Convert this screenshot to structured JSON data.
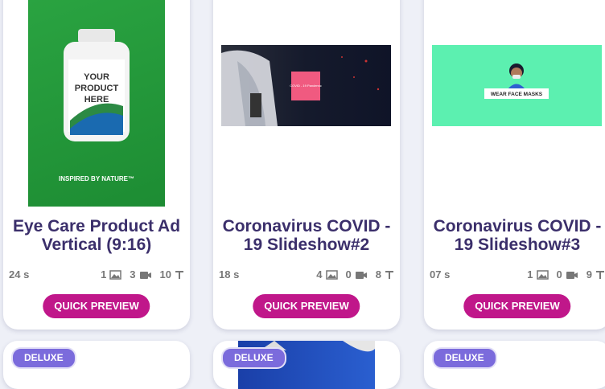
{
  "cards": [
    {
      "title": "Eye Care Product Ad Vertical (9:16)",
      "duration": "24 s",
      "images": "1",
      "videos": "3",
      "texts": "10",
      "preview_label": "QUICK PREVIEW",
      "thumb_text": {
        "line1": "YOUR",
        "line2": "PRODUCT",
        "line3": "HERE",
        "tagline": "INSPIRED BY NATURE™"
      }
    },
    {
      "title": "Coronavirus COVID - 19 Slideshow#2",
      "duration": "18 s",
      "images": "4",
      "videos": "0",
      "texts": "8",
      "preview_label": "QUICK PREVIEW",
      "thumb_text": {
        "box": "COVID - 19 Pandemic"
      }
    },
    {
      "title": "Coronavirus COVID - 19 Slideshow#3",
      "duration": "07 s",
      "images": "1",
      "videos": "0",
      "texts": "9",
      "preview_label": "QUICK PREVIEW",
      "thumb_text": {
        "banner": "WEAR FACE MASKS"
      }
    }
  ],
  "bottom_cards": [
    {
      "badge": "DELUXE"
    },
    {
      "badge": "DELUXE"
    },
    {
      "badge": "DELUXE"
    }
  ],
  "colors": {
    "title": "#3b2f6b",
    "button": "#c0178a",
    "badge": "#7b6bdc"
  },
  "icons": [
    "image-icon",
    "video-camera-icon",
    "text-icon"
  ]
}
